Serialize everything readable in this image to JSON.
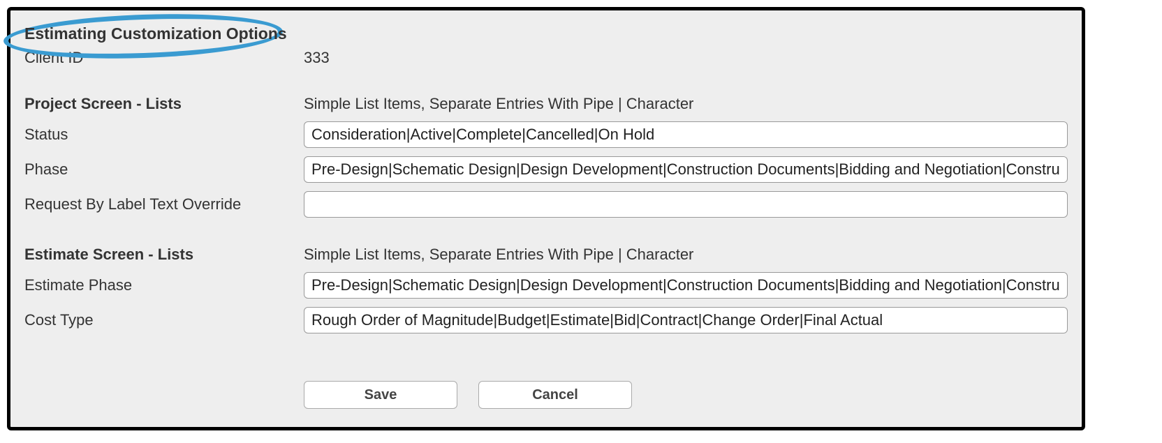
{
  "title": "Estimating Customization Options",
  "client_id_label": "Client ID",
  "client_id_value": "333",
  "project_section": {
    "header": "Project Screen - Lists",
    "hint": "Simple List Items, Separate Entries With Pipe | Character",
    "status_label": "Status",
    "status_value": "Consideration|Active|Complete|Cancelled|On Hold",
    "phase_label": "Phase",
    "phase_value": "Pre-Design|Schematic Design|Design Development|Construction Documents|Bidding and Negotiation|Construction",
    "request_by_label": "Request By Label Text Override",
    "request_by_value": ""
  },
  "estimate_section": {
    "header": "Estimate Screen - Lists",
    "hint": "Simple List Items, Separate Entries With Pipe | Character",
    "estimate_phase_label": "Estimate Phase",
    "estimate_phase_value": "Pre-Design|Schematic Design|Design Development|Construction Documents|Bidding and Negotiation|Construction",
    "cost_type_label": "Cost Type",
    "cost_type_value": "Rough Order of Magnitude|Budget|Estimate|Bid|Contract|Change Order|Final Actual"
  },
  "buttons": {
    "save": "Save",
    "cancel": "Cancel"
  }
}
